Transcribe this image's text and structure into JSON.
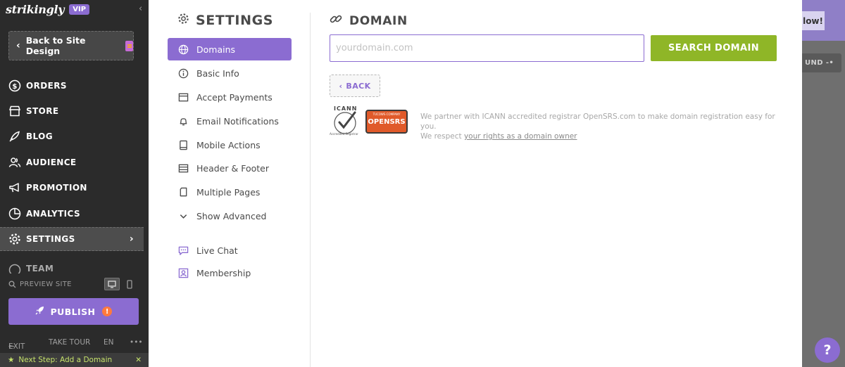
{
  "brand": {
    "logo_text": "strikingly",
    "badge": "VIP"
  },
  "sidebar": {
    "back_label": "Back to Site Design",
    "nav": [
      {
        "label": "ORDERS",
        "icon": "dollar-circle-icon"
      },
      {
        "label": "STORE",
        "icon": "store-icon"
      },
      {
        "label": "BLOG",
        "icon": "quill-icon"
      },
      {
        "label": "AUDIENCE",
        "icon": "people-icon"
      },
      {
        "label": "PROMOTION",
        "icon": "megaphone-icon"
      },
      {
        "label": "ANALYTICS",
        "icon": "pie-chart-icon"
      },
      {
        "label": "SETTINGS",
        "icon": "gear-icon",
        "active": true
      },
      {
        "label": "TEAM",
        "icon": "team-icon"
      }
    ],
    "preview_label": "PREVIEW SITE",
    "publish_label": "PUBLISH",
    "publish_warning": "!",
    "footer": {
      "exit": "EXIT",
      "tour": "TAKE TOUR",
      "lang": "EN",
      "more": "•••"
    },
    "next_step": "Next Step: Add a Domain"
  },
  "settings": {
    "title": "SETTINGS",
    "menu": [
      {
        "label": "Domains",
        "icon": "globe-icon",
        "active": true
      },
      {
        "label": "Basic Info",
        "icon": "info-icon"
      },
      {
        "label": "Accept Payments",
        "icon": "credit-card-icon"
      },
      {
        "label": "Email Notifications",
        "icon": "bell-icon"
      },
      {
        "label": "Mobile Actions",
        "icon": "mobile-icon"
      },
      {
        "label": "Header & Footer",
        "icon": "layout-icon"
      },
      {
        "label": "Multiple Pages",
        "icon": "pages-icon"
      },
      {
        "label": "Show Advanced",
        "icon": "chevron-down-icon"
      },
      {
        "label": "Live Chat",
        "icon": "chat-icon"
      },
      {
        "label": "Membership",
        "icon": "member-icon"
      }
    ]
  },
  "domain": {
    "title": "DOMAIN",
    "input_placeholder": "yourdomain.com",
    "input_value": "",
    "search_label": "SEARCH DOMAIN",
    "back_label": "BACK",
    "partner_text_1": "We partner with ICANN accredited registrar OpenSRS.com to make domain registration easy for you.",
    "partner_text_2": "We respect",
    "partner_link": "your rights as a domain owner",
    "logo_icann_text": "ICANN",
    "logo_icann_sub": "Accredited Registrar",
    "logo_opensrs_text": "OPENSRS",
    "logo_opensrs_top": "TUCOWS COMPANY"
  },
  "background": {
    "banner_text": "low!",
    "pill_text": "UND -•"
  },
  "help_label": "?",
  "colors": {
    "accent": "#8b6cd1",
    "search_green": "#8fb627",
    "sidebar_bg": "#2b2b2b"
  }
}
